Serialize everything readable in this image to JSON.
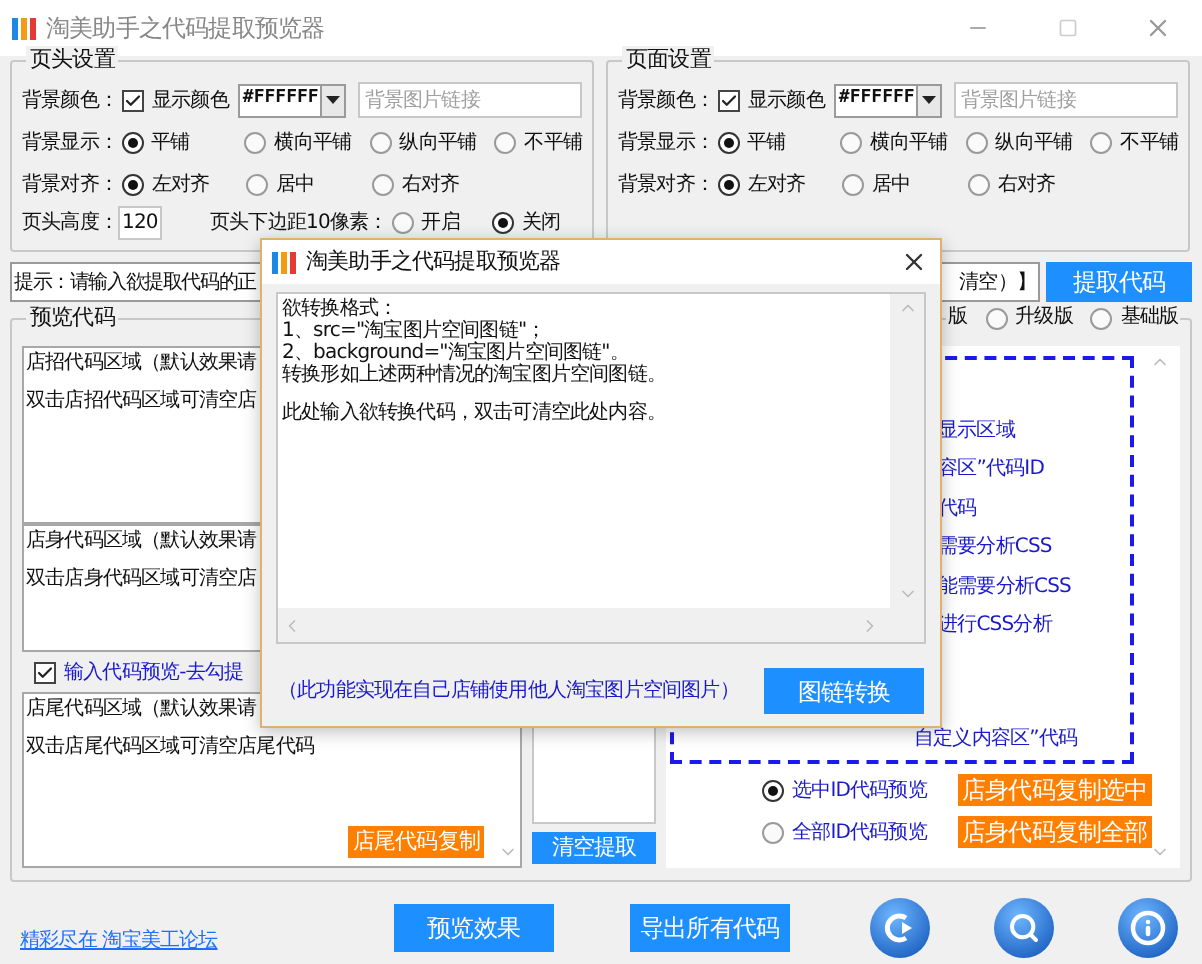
{
  "window": {
    "title": "淘美助手之代码提取预览器"
  },
  "header_settings": {
    "legend": "页头设置",
    "color_label": "背景颜色：",
    "show_color": {
      "label": "显示颜色",
      "checked": true
    },
    "color_value": "#FFFFFF",
    "image_placeholder": "背景图片链接",
    "display": {
      "label": "背景显示：",
      "options": [
        {
          "label": "平铺",
          "selected": true
        },
        {
          "label": "横向平铺",
          "selected": false
        },
        {
          "label": "纵向平铺",
          "selected": false
        },
        {
          "label": "不平铺",
          "selected": false
        }
      ]
    },
    "align": {
      "label": "背景对齐：",
      "options": [
        {
          "label": "左对齐",
          "selected": true
        },
        {
          "label": "居中",
          "selected": false
        },
        {
          "label": "右对齐",
          "selected": false
        }
      ]
    },
    "height": {
      "label": "页头高度：",
      "value": "120"
    },
    "margin": {
      "label": "页头下边距10像素：",
      "options": [
        {
          "label": "开启",
          "selected": false
        },
        {
          "label": "关闭",
          "selected": true
        }
      ]
    }
  },
  "page_settings": {
    "legend": "页面设置",
    "color_label": "背景颜色：",
    "show_color": {
      "label": "显示颜色",
      "checked": true
    },
    "color_value": "#FFFFFF",
    "image_placeholder": "背景图片链接",
    "display": {
      "label": "背景显示：",
      "options": [
        {
          "label": "平铺",
          "selected": true
        },
        {
          "label": "横向平铺",
          "selected": false
        },
        {
          "label": "纵向平铺",
          "selected": false
        },
        {
          "label": "不平铺",
          "selected": false
        }
      ]
    },
    "align": {
      "label": "背景对齐：",
      "options": [
        {
          "label": "左对齐",
          "selected": true
        },
        {
          "label": "居中",
          "selected": false
        },
        {
          "label": "右对齐",
          "selected": false
        }
      ]
    }
  },
  "hint": {
    "value_left": "提示：请输入欲提取代码的正",
    "value_right": "清空）】"
  },
  "extract_button": "提取代码",
  "preview": {
    "legend": "预览代码",
    "areas": [
      {
        "title": "店招代码区域（默认效果请",
        "hint": "双击店招代码区域可清空店"
      },
      {
        "title": "店身代码区域（默认效果请",
        "hint": "双击店身代码区域可清空店"
      }
    ],
    "preview_checkbox": {
      "label": "输入代码预览-去勾提",
      "checked": true
    },
    "footer_area": {
      "title": "店尾代码区域（默认效果请",
      "hint": "双击店尾代码区域可清空店尾代码"
    },
    "copy_footer_button": "店尾代码复制",
    "clear_button": "清空提取",
    "version_cut": "版",
    "versions": [
      {
        "label": "升级版",
        "selected": false
      },
      {
        "label": "基础版",
        "selected": false
      }
    ],
    "info_lines": [
      "显示区域",
      "容区”代码ID",
      "代码",
      "需要分析CSS",
      "能需要分析CSS",
      "进行CSS分析"
    ],
    "info_last": "自定义内容区”代码",
    "id_options": [
      {
        "label": "选中ID代码预览",
        "selected": true,
        "button": "店身代码复制选中"
      },
      {
        "label": "全部ID代码预览",
        "selected": false,
        "button": "店身代码复制全部"
      }
    ]
  },
  "footer": {
    "link": "精彩尽在 淘宝美工论坛",
    "buttons": [
      "预览效果",
      "导出所有代码"
    ]
  },
  "dialog": {
    "title": "淘美助手之代码提取预览器",
    "paragraphs": [
      [
        "欲转换格式：",
        "1、src=\"淘宝图片空间图链\"；",
        "2、background=\"淘宝图片空间图链\"。",
        "转换形如上述两种情况的淘宝图片空间图链。"
      ],
      [
        "此处输入欲转换代码，双击可清空此处内容。"
      ]
    ],
    "note": "（此功能实现在自己店铺使用他人淘宝图片空间图片）",
    "button": "图链转换"
  }
}
